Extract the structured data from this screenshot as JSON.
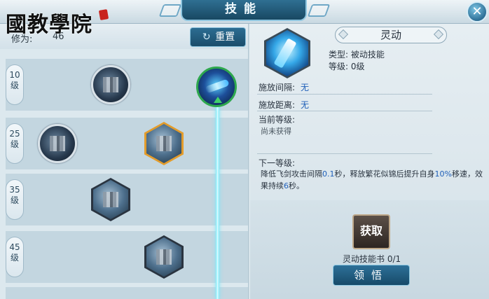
{
  "watermark": {
    "logo_text": "國教學院"
  },
  "header": {
    "title": "技能",
    "close_glyph": "✕"
  },
  "left": {
    "cultivation_label": "修为:",
    "cultivation_value": "46",
    "reset_label": "重置",
    "reset_icon": "↻",
    "tiers": [
      {
        "level": "10",
        "unit": "级"
      },
      {
        "level": "25",
        "unit": "级"
      },
      {
        "level": "35",
        "unit": "级"
      },
      {
        "level": "45",
        "unit": "级"
      }
    ]
  },
  "detail": {
    "name": "灵动",
    "type_line": "类型: 被动技能",
    "level_line": "等级: 0级",
    "interval_label": "施放间隔:",
    "interval_value": "无",
    "distance_label": "施放距离:",
    "distance_value": "无",
    "current_level_label": "当前等级:",
    "current_level_value": "尚未获得",
    "next_level_label": "下一等级:",
    "next_desc_part1": "降低飞剑攻击间隔",
    "next_desc_hl1": "0.1",
    "next_desc_part2": "秒，释放繁花似锦后提升自身",
    "next_desc_hl2": "10%",
    "next_desc_part3": "移速，效果持续",
    "next_desc_hl3": "6",
    "next_desc_part4": "秒。",
    "acquire_label": "获取",
    "book_count": "灵动技能书 0/1",
    "comprehend_label": "领悟"
  },
  "colors": {
    "accent_blue": "#1f5fb8",
    "selected_border": "#e39c2b",
    "progress_cyan": "#7fe9f6",
    "unlocked_ring": "#2ea84e"
  },
  "icons": [
    "refresh-icon",
    "close-icon",
    "skill-icon"
  ]
}
